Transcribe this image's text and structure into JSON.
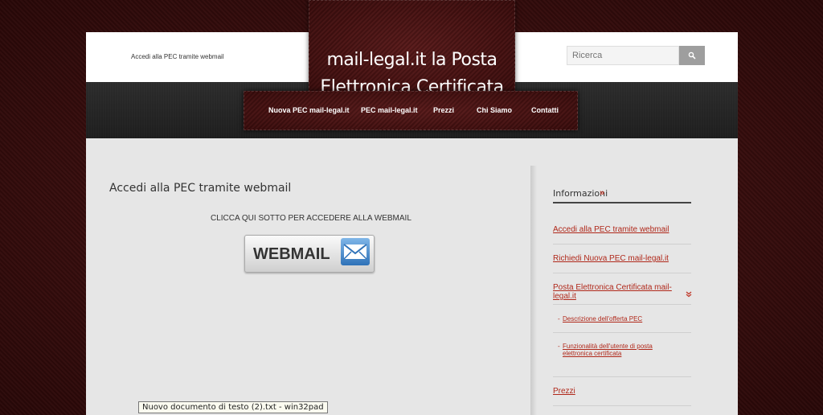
{
  "header": {
    "top_link": "Accedi alla PEC tramite webmail",
    "logo_title": "mail-legal.it la Posta Elettronica Certificata",
    "search_placeholder": "Ricerca",
    "search_icon": "search-icon"
  },
  "nav": {
    "items": [
      {
        "label": "Nuova PEC mail-legal.it"
      },
      {
        "label": "PEC mail-legal.it"
      },
      {
        "label": "Prezzi"
      },
      {
        "label": "Chi Siamo"
      },
      {
        "label": "Contatti"
      }
    ]
  },
  "main": {
    "title": "Accedi alla PEC tramite webmail",
    "instruction": "CLICCA QUI SOTTO PER ACCEDERE ALLA WEBMAIL",
    "webmail_label": "WEBMAIL",
    "webmail_icon": "envelope-icon"
  },
  "sidebar": {
    "title": "Informazioni",
    "title_arrow": "»",
    "links": [
      {
        "label": "Accedi alla PEC tramite webmail"
      },
      {
        "label": "Richiedi Nuova PEC mail-legal.it"
      },
      {
        "label": "Posta Elettronica Certificata mail-legal.it"
      },
      {
        "label": "Prezzi"
      }
    ],
    "expand_icon": "double-chevron-down-icon",
    "sublinks": [
      {
        "label": "Descrizione dell'offerta PEC"
      },
      {
        "label": "Funzionalità dell'utente di posta elettronica certificata"
      }
    ]
  },
  "tooltip": {
    "text": "Nuovo documento di testo (2).txt - win32pad"
  },
  "colors": {
    "accent_link": "#b0281a",
    "leather": "#4a1414",
    "nav_dark": "#262626"
  }
}
